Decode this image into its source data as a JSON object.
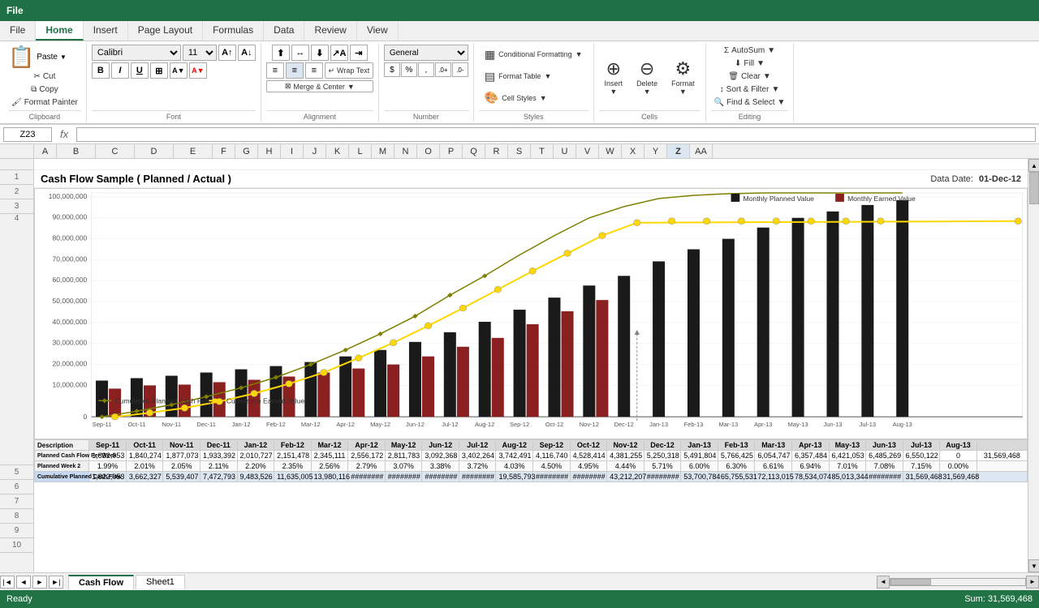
{
  "ribbon": {
    "app_title": "File",
    "tabs": [
      "File",
      "Home",
      "Insert",
      "Page Layout",
      "Formulas",
      "Data",
      "Review",
      "View"
    ],
    "active_tab": "Home",
    "clipboard": {
      "cut": "Cut",
      "copy": "Copy",
      "format_painter": "Format Painter",
      "group_label": "Clipboard"
    },
    "font": {
      "family": "Calibri",
      "size": "11",
      "bold_label": "B",
      "italic_label": "I",
      "underline_label": "U",
      "group_label": "Font"
    },
    "alignment": {
      "wrap_text": "Wrap Text",
      "merge_center": "Merge & Center",
      "group_label": "Alignment"
    },
    "number": {
      "format": "General",
      "currency": "$",
      "percent": "%",
      "comma": ",",
      "increase_decimal": ".0→.00",
      "decrease_decimal": ".00→.0",
      "group_label": "Number"
    },
    "styles": {
      "conditional_formatting": "Conditional Formatting",
      "format_as_table": "Format Table",
      "cell_styles": "Cell Styles",
      "group_label": "Styles"
    },
    "cells": {
      "insert": "Insert",
      "delete": "Delete",
      "format": "Format",
      "group_label": "Cells"
    },
    "editing": {
      "autosum": "AutoSum",
      "fill": "Fill",
      "clear": "Clear",
      "sort_filter": "Sort & Filter",
      "find_select": "Find & Select",
      "group_label": "Editing"
    }
  },
  "formula_bar": {
    "cell_ref": "Z23",
    "formula": ""
  },
  "column_headers": [
    "A",
    "B",
    "C",
    "D",
    "E",
    "F",
    "G",
    "H",
    "I",
    "J",
    "K",
    "L",
    "M",
    "N",
    "O",
    "P",
    "Q",
    "R",
    "S",
    "T",
    "U",
    "V",
    "W",
    "X",
    "Y",
    "Z",
    "AA"
  ],
  "spreadsheet": {
    "title": "Cash Flow Sample ( Planned / Actual )",
    "data_date_label": "Data Date:",
    "data_date_value": "01-Dec-12"
  },
  "chart": {
    "legend": [
      "Monthly Planned Value",
      "Monthly Earned Value",
      "Cumulative Planned Cash Flow",
      "Cumulative Earned Value"
    ],
    "y_axis_labels": [
      "100,000,000",
      "90,000,000",
      "80,000,000",
      "70,000,000",
      "60,000,000",
      "50,000,000",
      "40,000,000",
      "30,000,000",
      "20,000,000",
      "10,000,000",
      "0"
    ],
    "x_axis_labels": [
      "Sep-11",
      "Oct-11",
      "Nov-11",
      "Dec-11",
      "Jan-12",
      "Feb-12",
      "Mar-12",
      "Apr-12",
      "May-12",
      "Jun-12",
      "Jul-12",
      "Aug-12",
      "Sep-12",
      "Oct-12",
      "Nov-12",
      "Dec-12",
      "Jan-13",
      "Feb-13",
      "Mar-13",
      "Apr-13",
      "May-13",
      "Jun-13",
      "Jul-13",
      "Aug-13"
    ]
  },
  "table": {
    "headers": [
      "Description",
      "Sep-11",
      "Oct-11",
      "Nov-11",
      "Dec-11",
      "Jan-12",
      "Feb-12",
      "Mar-12",
      "Apr-12",
      "May-12",
      "Jun-12",
      "Jul-12",
      "Aug-12",
      "Sep-12",
      "Oct-12",
      "Nov-12",
      "Dec-12",
      "Jan-13",
      "Feb-13",
      "Mar-13",
      "Apr-13",
      "May-13",
      "Jun-13",
      "Jul-13",
      "Aug-13",
      ""
    ],
    "rows": [
      {
        "label": "Planned Cash Flow Per Week",
        "values": [
          "1,822,053",
          "1,840,274",
          "1,877,073",
          "1,933,392",
          "2,010,727",
          "2,151,478",
          "2,345,111",
          "2,556,172",
          "2,811,783",
          "3,092,368",
          "3,402,264",
          "3,742,491",
          "4,116,740",
          "4,528,414",
          "4,381,255",
          "5,250,318",
          "5,491,804",
          "5,766,425",
          "6,054,747",
          "6,357,484",
          "6,421,053",
          "6,485,269",
          "6,550,122",
          "0"
        ],
        "last": "31,569,468"
      },
      {
        "label": "Planned Week 2",
        "values": [
          "1.99%",
          "2.01%",
          "2.05%",
          "2.11%",
          "2.20%",
          "2.35%",
          "2.56%",
          "2.79%",
          "3.07%",
          "3.38%",
          "3.72%",
          "4.03%",
          "4.50%",
          "4.95%",
          "4.44%",
          "5.71%",
          "6.00%",
          "6.30%",
          "6.61%",
          "6.94%",
          "7.01%",
          "7.08%",
          "7.15%",
          "0.00%"
        ],
        "last": ""
      },
      {
        "label": "Cumulative Planned Cash Flow",
        "values": [
          "1,822,053",
          "3,662,327",
          "5,539,407",
          "7,472,793",
          "9,483,526",
          "11,635,005",
          "13,980,116",
          "########",
          "########",
          "########",
          "########",
          "19,585,793",
          "########",
          "########",
          "43,212,207",
          "########",
          "53,700,784",
          "65,755,531",
          "72,113,015",
          "78,534,074",
          "85,013,344",
          "########",
          "31,569,468",
          "31,569,468"
        ],
        "last": ""
      }
    ]
  },
  "sheet_tabs": [
    "Cash Flow",
    "Sheet1"
  ],
  "active_sheet": "Cash Flow",
  "status_bar": {
    "text": "Ready",
    "sum_label": "Sum:",
    "sum_value": "31,569,468"
  }
}
